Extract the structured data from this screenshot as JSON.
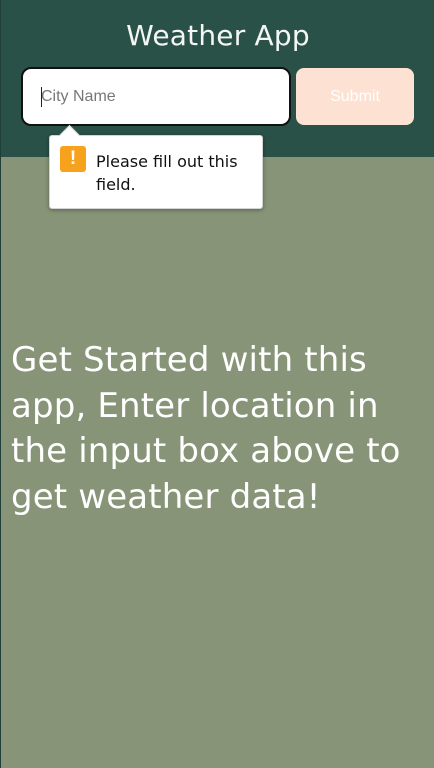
{
  "header": {
    "title": "Weather App"
  },
  "search": {
    "placeholder": "City Name",
    "value": "",
    "submit_label": "Submit"
  },
  "validation": {
    "message": "Please fill out this field.",
    "icon": "warning-icon"
  },
  "main": {
    "message": "Get Started with this app, Enter location in the input box above to get weather data!"
  },
  "colors": {
    "header_bg": "#2a5148",
    "page_bg": "#879477",
    "submit_bg": "#fde1d2",
    "warning": "#f7a21d"
  }
}
